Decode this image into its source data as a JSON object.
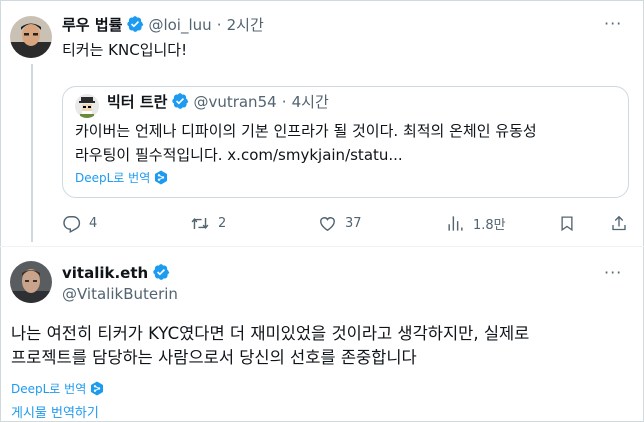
{
  "reply": {
    "name": "루우 법률",
    "handle": "@loi_luu",
    "dot": "·",
    "time": "2시간",
    "text": "티커는 KNC입니다!",
    "more": "···"
  },
  "quote": {
    "name": "빅터 트란",
    "handle": "@vutran54",
    "dot": "·",
    "time": "4시간",
    "line1": "카이버는 언제나 디파이의 기본 인프라가 될 것이다. 최적의 온체인 유동성",
    "line2": "라우팅이 필수적입니다. x.com/smykjain/statu...",
    "translate": "DeepL로 번역"
  },
  "actions": {
    "reply_count": "4",
    "retweet_count": "2",
    "like_count": "37",
    "view_count": "1.8만"
  },
  "main": {
    "name": "vitalik.eth",
    "handle": "@VitalikButerin",
    "more": "···",
    "line1": "나는 여전히 티커가 KYC였다면 더 재미있었을 것이라고 생각하지만, 실제로",
    "line2": "프로젝트를 담당하는 사람으로서 당신의 선호를 존중합니다",
    "translate": "DeepL로 번역",
    "translate_post": "게시물 번역하기"
  },
  "colors": {
    "accent": "#1d9bf0",
    "secondary_text": "#536471",
    "border": "#cfd9de"
  }
}
